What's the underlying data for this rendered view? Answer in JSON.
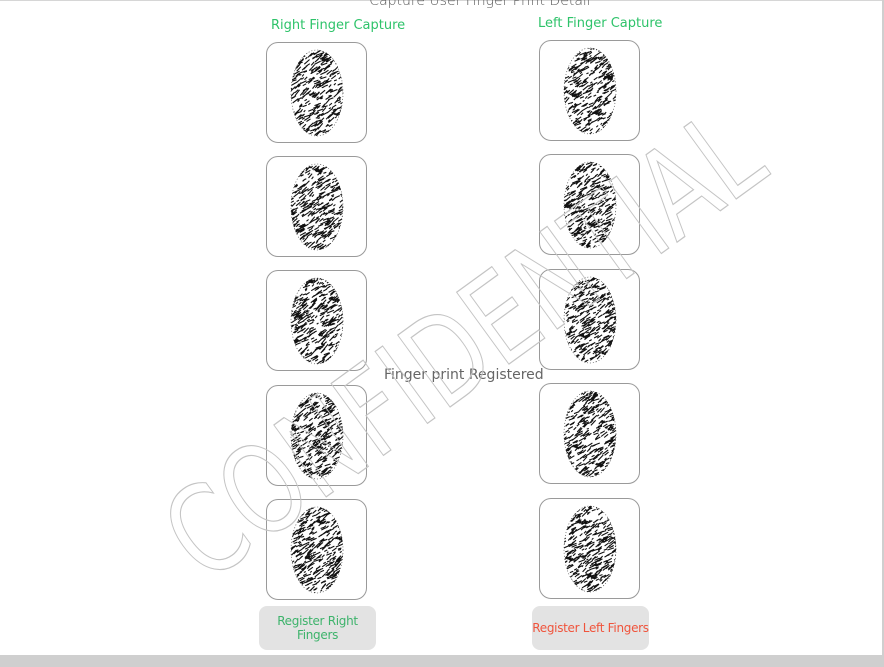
{
  "title": "Capture User Finger Print Detail",
  "right_column": {
    "title": "Right Finger Capture",
    "fingers": [
      {
        "icon": "fingerprint-icon"
      },
      {
        "icon": "fingerprint-icon"
      },
      {
        "icon": "fingerprint-icon"
      },
      {
        "icon": "fingerprint-icon"
      },
      {
        "icon": "fingerprint-icon"
      }
    ],
    "button_label": "Register Right Fingers",
    "button_color": "#3db36b"
  },
  "left_column": {
    "title": "Left Finger Capture",
    "fingers": [
      {
        "icon": "fingerprint-icon"
      },
      {
        "icon": "fingerprint-icon"
      },
      {
        "icon": "fingerprint-icon"
      },
      {
        "icon": "fingerprint-icon"
      },
      {
        "icon": "fingerprint-icon"
      }
    ],
    "button_label": "Register Left Fingers",
    "button_color": "#f0543c"
  },
  "status": "Finger print Registered",
  "watermark": "CONFIDENTIAL",
  "colors": {
    "title_green": "#2ec36a",
    "button_bg": "#e3e3e3"
  }
}
